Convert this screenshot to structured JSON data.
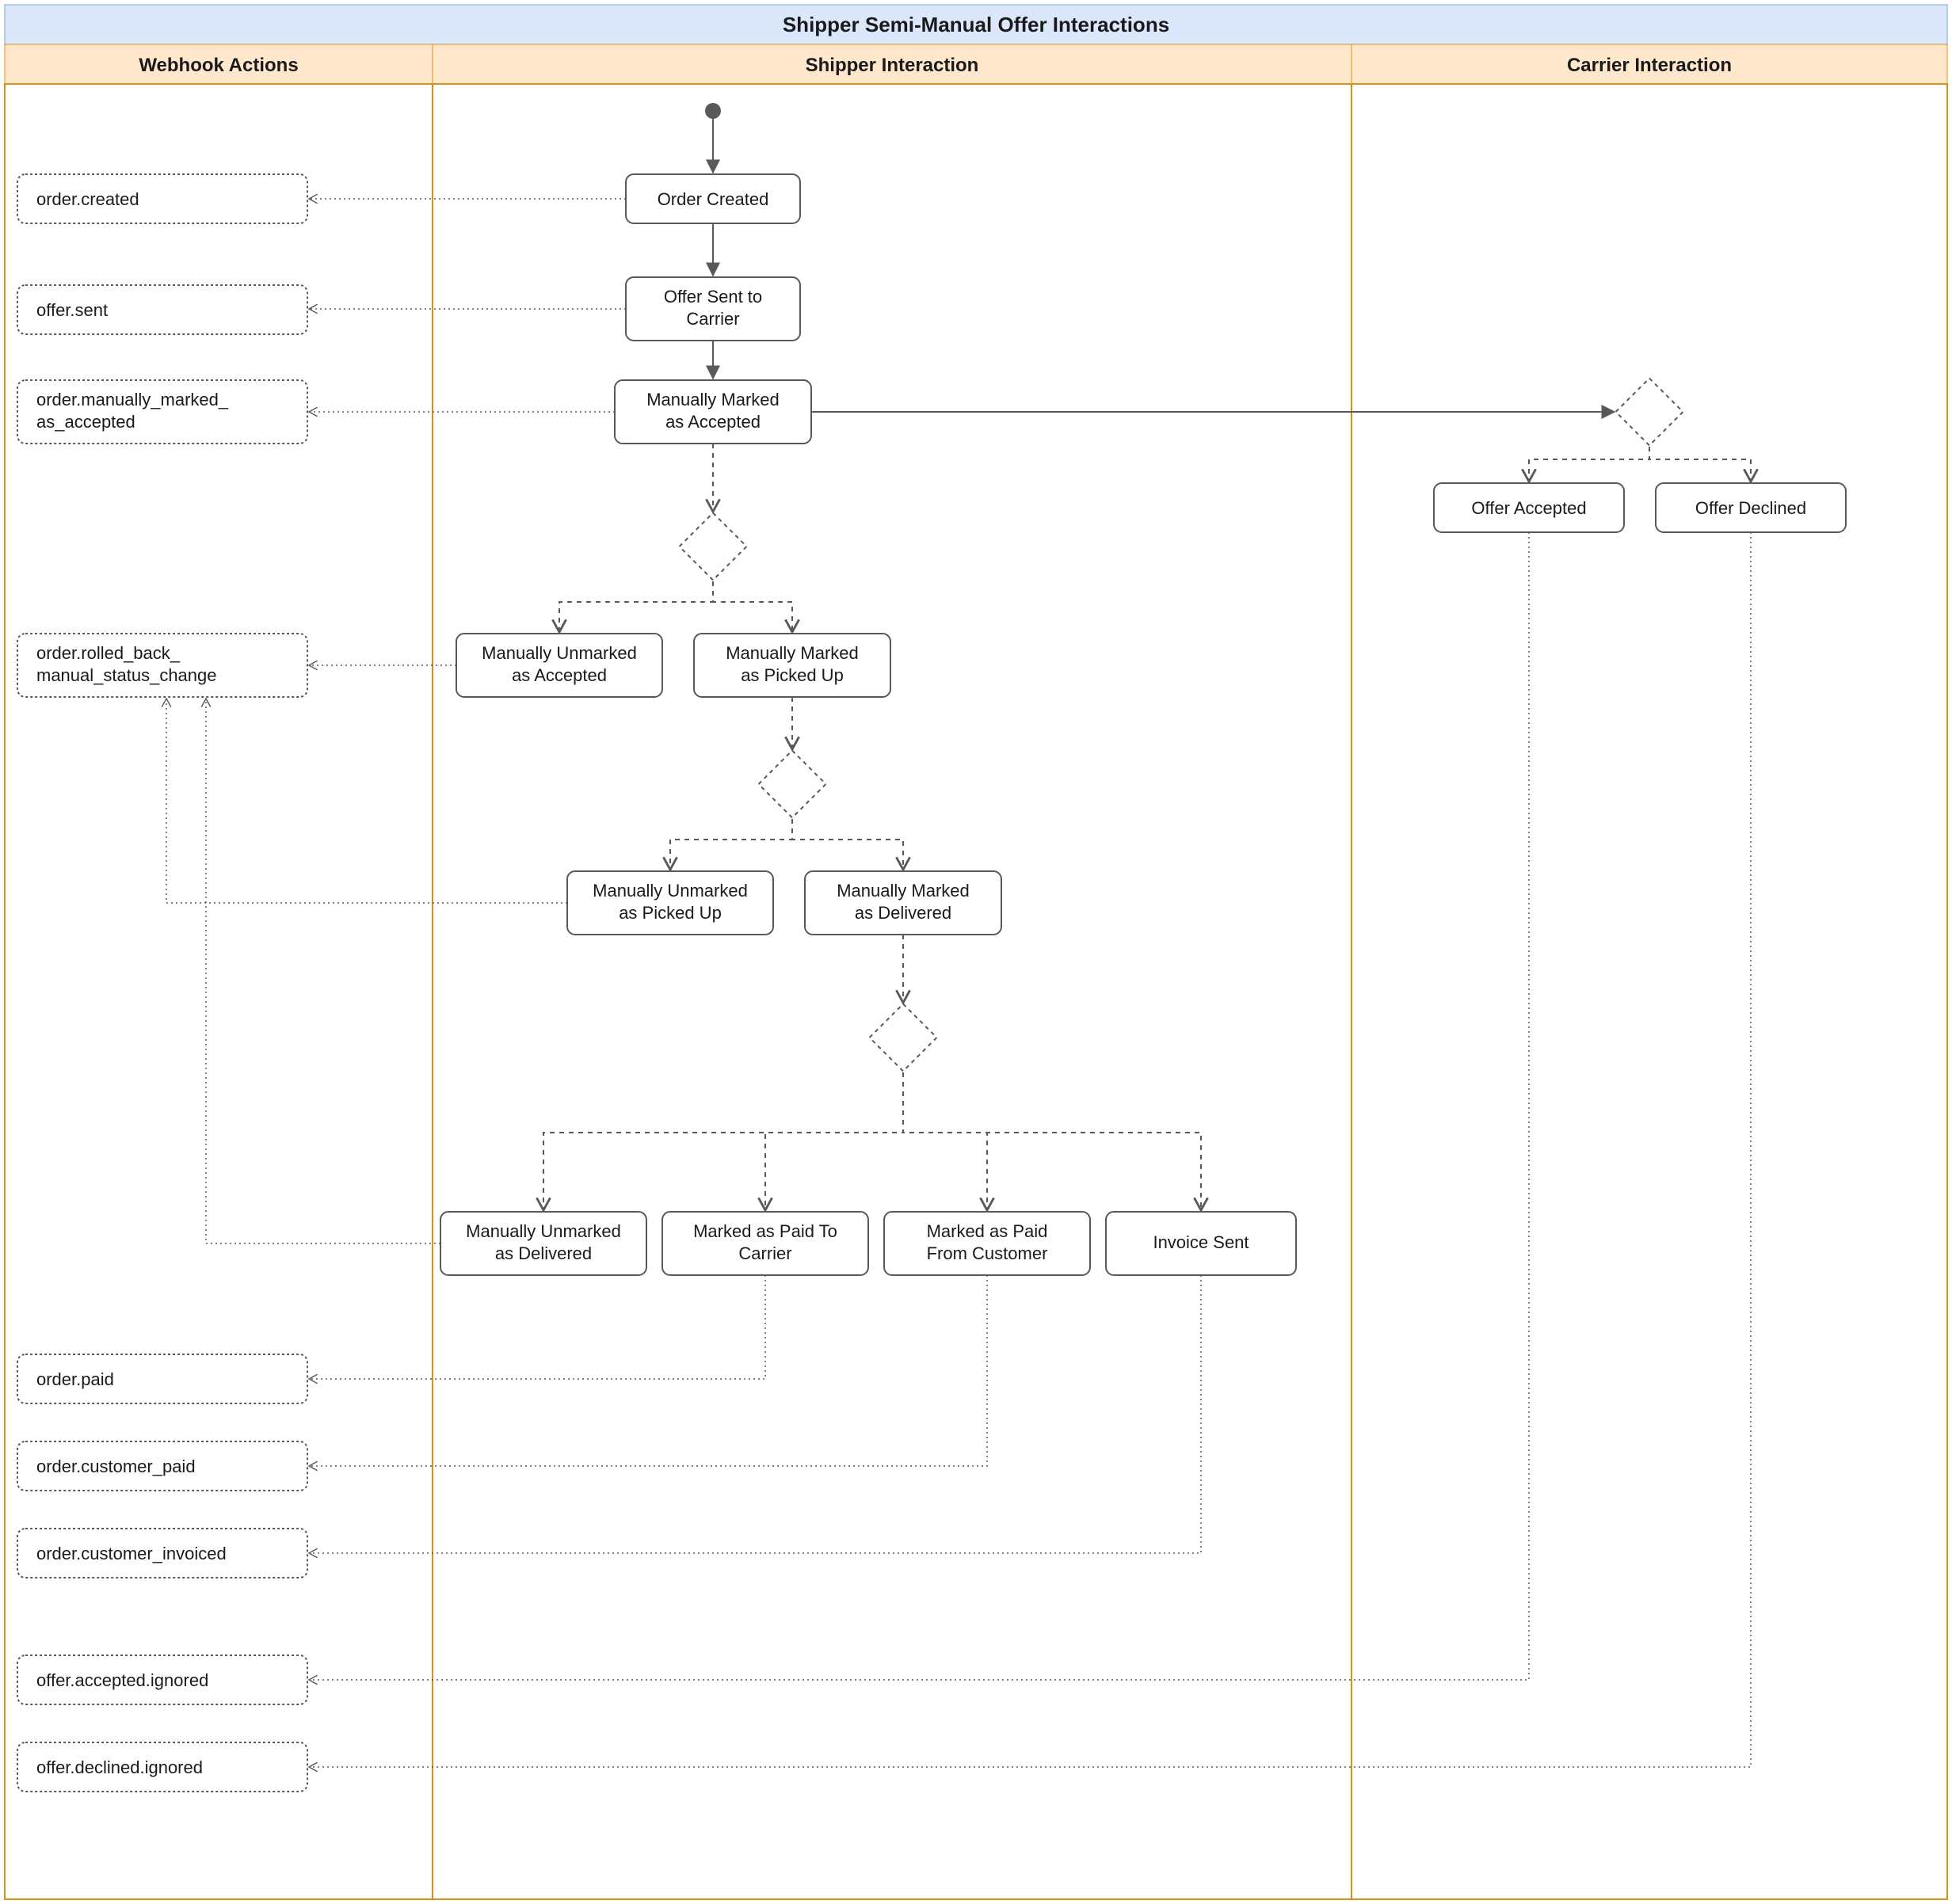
{
  "title": "Shipper Semi-Manual Offer Interactions",
  "lanes": {
    "webhook": "Webhook Actions",
    "shipper": "Shipper Interaction",
    "carrier": "Carrier Interaction"
  },
  "webhooks": {
    "created": "order.created",
    "sent": "offer.sent",
    "marked_accepted_l1": "order.manually_marked_",
    "marked_accepted_l2": "as_accepted",
    "rolled_back_l1": "order.rolled_back_",
    "rolled_back_l2": "manual_status_change",
    "paid": "order.paid",
    "customer_paid": "order.customer_paid",
    "customer_invoiced": "order.customer_invoiced",
    "accepted_ignored": "offer.accepted.ignored",
    "declined_ignored": "offer.declined.ignored"
  },
  "nodes": {
    "order_created": "Order Created",
    "offer_sent_l1": "Offer Sent to",
    "offer_sent_l2": "Carrier",
    "marked_accepted_l1": "Manually Marked",
    "marked_accepted_l2": "as Accepted",
    "unmarked_accepted_l1": "Manually Unmarked",
    "unmarked_accepted_l2": "as Accepted",
    "marked_picked_l1": "Manually Marked",
    "marked_picked_l2": "as Picked Up",
    "unmarked_picked_l1": "Manually Unmarked",
    "unmarked_picked_l2": "as Picked Up",
    "marked_delivered_l1": "Manually Marked",
    "marked_delivered_l2": "as Delivered",
    "unmarked_delivered_l1": "Manually Unmarked",
    "unmarked_delivered_l2": "as Delivered",
    "paid_carrier_l1": "Marked as Paid To",
    "paid_carrier_l2": "Carrier",
    "paid_customer_l1": "Marked as Paid",
    "paid_customer_l2": "From Customer",
    "invoice_sent": "Invoice Sent",
    "offer_accepted": "Offer Accepted",
    "offer_declined": "Offer Declined"
  }
}
